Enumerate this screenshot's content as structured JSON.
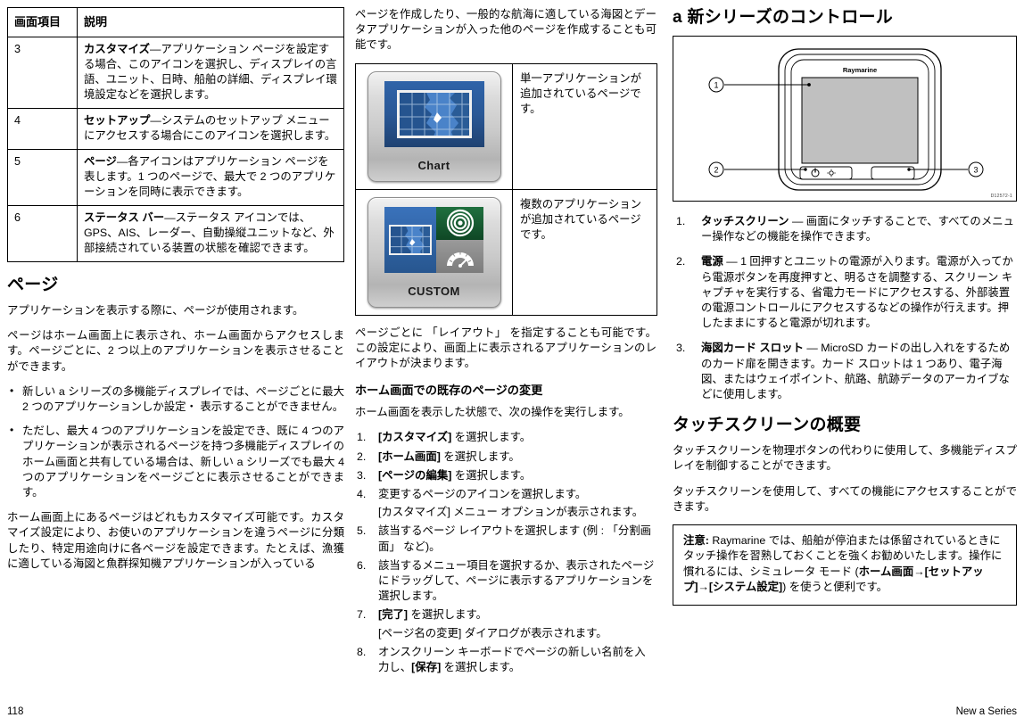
{
  "table": {
    "headers": [
      "画面項目",
      "説明"
    ],
    "rows": [
      {
        "item": "3",
        "term": "カスタマイズ",
        "dash": "—",
        "desc": "アプリケーション ページを設定する場合、このアイコンを選択し、ディスプレイの言語、ユニット、日時、船舶の詳細、ディスプレイ環境設定などを選択します。"
      },
      {
        "item": "4",
        "term": "セットアップ",
        "dash": "—",
        "desc": "システムのセットアップ メニューにアクセスする場合にこのアイコンを選択します。"
      },
      {
        "item": "5",
        "term": "ページ",
        "dash": "—",
        "desc": "各アイコンはアプリケーション ページを表します。1 つのページで、最大で 2 つのアプリケーションを同時に表示できます。"
      },
      {
        "item": "6",
        "term": "ステータス バー",
        "dash": "—",
        "desc": "ステータス アイコンでは、GPS、AIS、レーダー、自動操縦ユニットなど、外部接続されている装置の状態を確認できます。"
      }
    ]
  },
  "pages_section": {
    "heading": "ページ",
    "para1": "アプリケーションを表示する際に、ページが使用されます。",
    "para2": "ページはホーム画面上に表示され、ホーム画面からアクセスします。ページごとに、2 つ以上のアプリケーションを表示させることができます。",
    "bullets": [
      "新しい a シリーズの多機能ディスプレイでは、ページごとに最大 2 つのアプリケーションしか設定・ 表示することができません。",
      "ただし、最大 4 つのアプリケーションを設定でき、既に 4 つのアプリケーションが表示されるページを持つ多機能ディスプレイのホーム画面と共有している場合は、新しい a シリーズでも最大 4 つのアプリケーションをページごとに表示させることができます。"
    ],
    "para3": "ホーム画面上にあるページはどれもカスタマイズ可能です。カスタマイズ設定により、お使いのアプリケーションを違うページに分類したり、特定用途向けに各ページを設定できます。たとえば、漁獲に適している海図と魚群探知機アプリケーションが入っている",
    "para3_cont": "ページを作成したり、一般的な航海に適している海図とデータアプリケーションが入った他のページを作成することも可能です。"
  },
  "icon_table": {
    "rows": [
      {
        "icon_name": "chart-app-tile",
        "label": "Chart",
        "desc": "単一アプリケーションが追加されているページです。"
      },
      {
        "icon_name": "custom-app-tile",
        "label": "CUSTOM",
        "desc": "複数のアプリケーションが追加されているページです。"
      }
    ]
  },
  "layout_para": "ページごとに 「レイアウト」 を指定することも可能です。この設定により、画面上に表示されるアプリケーションのレイアウトが決まります。",
  "modify_section": {
    "heading": "ホーム画面での既存のページの変更",
    "intro": "ホーム画面を表示した状態で、次の操作を実行します。",
    "steps": [
      {
        "bold": "[カスタマイズ]",
        "rest": " を選択します。"
      },
      {
        "bold": "[ホーム画面]",
        "rest": " を選択します。"
      },
      {
        "bold": "[ページの編集]",
        "rest": " を選択します。"
      },
      {
        "bold": "",
        "rest": "変更するページのアイコンを選択します。",
        "sub": "[カスタマイズ] メニュー オプションが表示されます。"
      },
      {
        "bold": "",
        "rest": "該当するページ レイアウトを選択します (例 : 「分割画面」 など)。"
      },
      {
        "bold": "",
        "rest": "該当するメニュー項目を選択するか、表示されたページにドラッグして、ページに表示するアプリケーションを選択します。"
      },
      {
        "bold": "[完了]",
        "rest": " を選択します。",
        "sub": "[ページ名の変更] ダイアログが表示されます。"
      },
      {
        "bold": "",
        "rest": "オンスクリーン キーボードでページの新しい名前を入力し、",
        "bold2": "[保存]",
        "rest2": " を選択します。"
      }
    ]
  },
  "controls_section": {
    "heading": "a 新シリーズのコントロール",
    "figure": {
      "brand": "Raymarine",
      "figure_id": "D12572-1",
      "callouts": [
        "1",
        "2",
        "3"
      ],
      "power_icon": "power-icon",
      "brightness_icon": "brightness-icon"
    },
    "items": [
      {
        "term": "タッチスクリーン",
        "dash": "—",
        "desc": " 画面にタッチすることで、すべてのメニュー操作などの機能を操作できます。"
      },
      {
        "term": "電源",
        "dash": "—",
        "desc": " 1 回押すとユニットの電源が入ります。電源が入ってから電源ボタンを再度押すと、明るさを調整する、スクリーン キャプチャを実行する、省電力モードにアクセスする、外部装置の電源コントロールにアクセスするなどの操作が行えます。押したままにすると電源が切れます。"
      },
      {
        "term": "海図カード スロット",
        "dash": "—",
        "desc": " MicroSD カードの出し入れをするためのカード扉を開きます。カード スロットは 1 つあり、電子海図、またはウェイポイント、航路、航跡データのアーカイブなどに使用します。"
      }
    ]
  },
  "touchscreen_section": {
    "heading": "タッチスクリーンの概要",
    "para1": "タッチスクリーンを物理ボタンの代わりに使用して、多機能ディスプレイを制御することができます。",
    "para2": "タッチスクリーンを使用して、すべての機能にアクセスすることができます。",
    "note": {
      "label": "注意:",
      "text_a": " Raymarine では、船舶が停泊または係留されているときにタッチ操作を習熟しておくことを強くお勧めいたします。操作に慣れるには、シミュレータ モード (",
      "bold_a": "ホーム画面",
      "arrow1": "→",
      "bold_b": "[セットアップ]",
      "arrow2": "→",
      "bold_c": "[システム設定]",
      "text_b": ") を使うと便利です。"
    }
  },
  "footer": {
    "page_number": "118",
    "doc_title": "New a Series"
  }
}
